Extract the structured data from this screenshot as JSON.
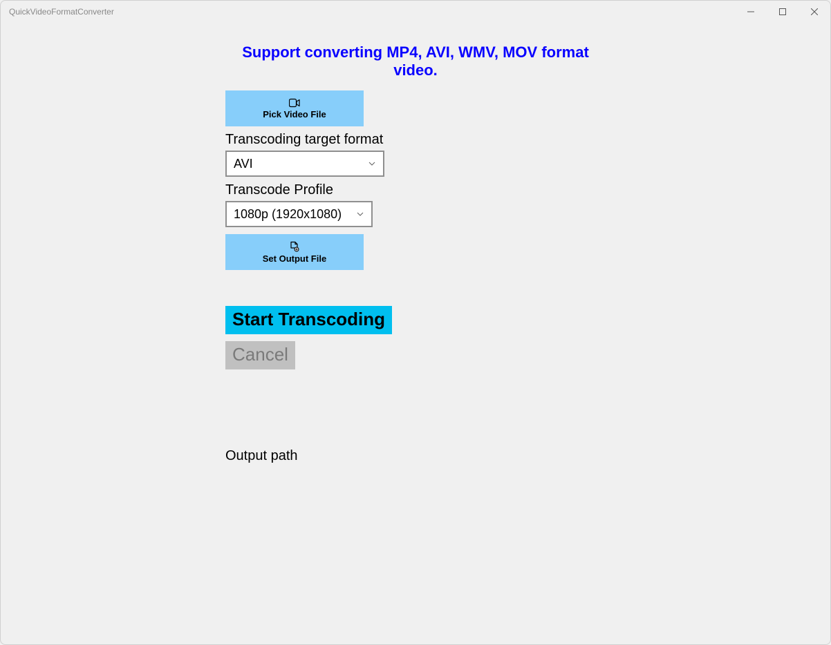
{
  "window": {
    "title": "QuickVideoFormatConverter"
  },
  "banner": "Support converting MP4, AVI, WMV, MOV format video.",
  "buttons": {
    "pick_video": "Pick Video File",
    "set_output": "Set Output File",
    "start": "Start Transcoding",
    "cancel": "Cancel"
  },
  "labels": {
    "target_format": "Transcoding target format",
    "profile": "Transcode Profile",
    "output_path": "Output path"
  },
  "combos": {
    "format_value": "AVI",
    "profile_value": "1080p (1920x1080)"
  }
}
